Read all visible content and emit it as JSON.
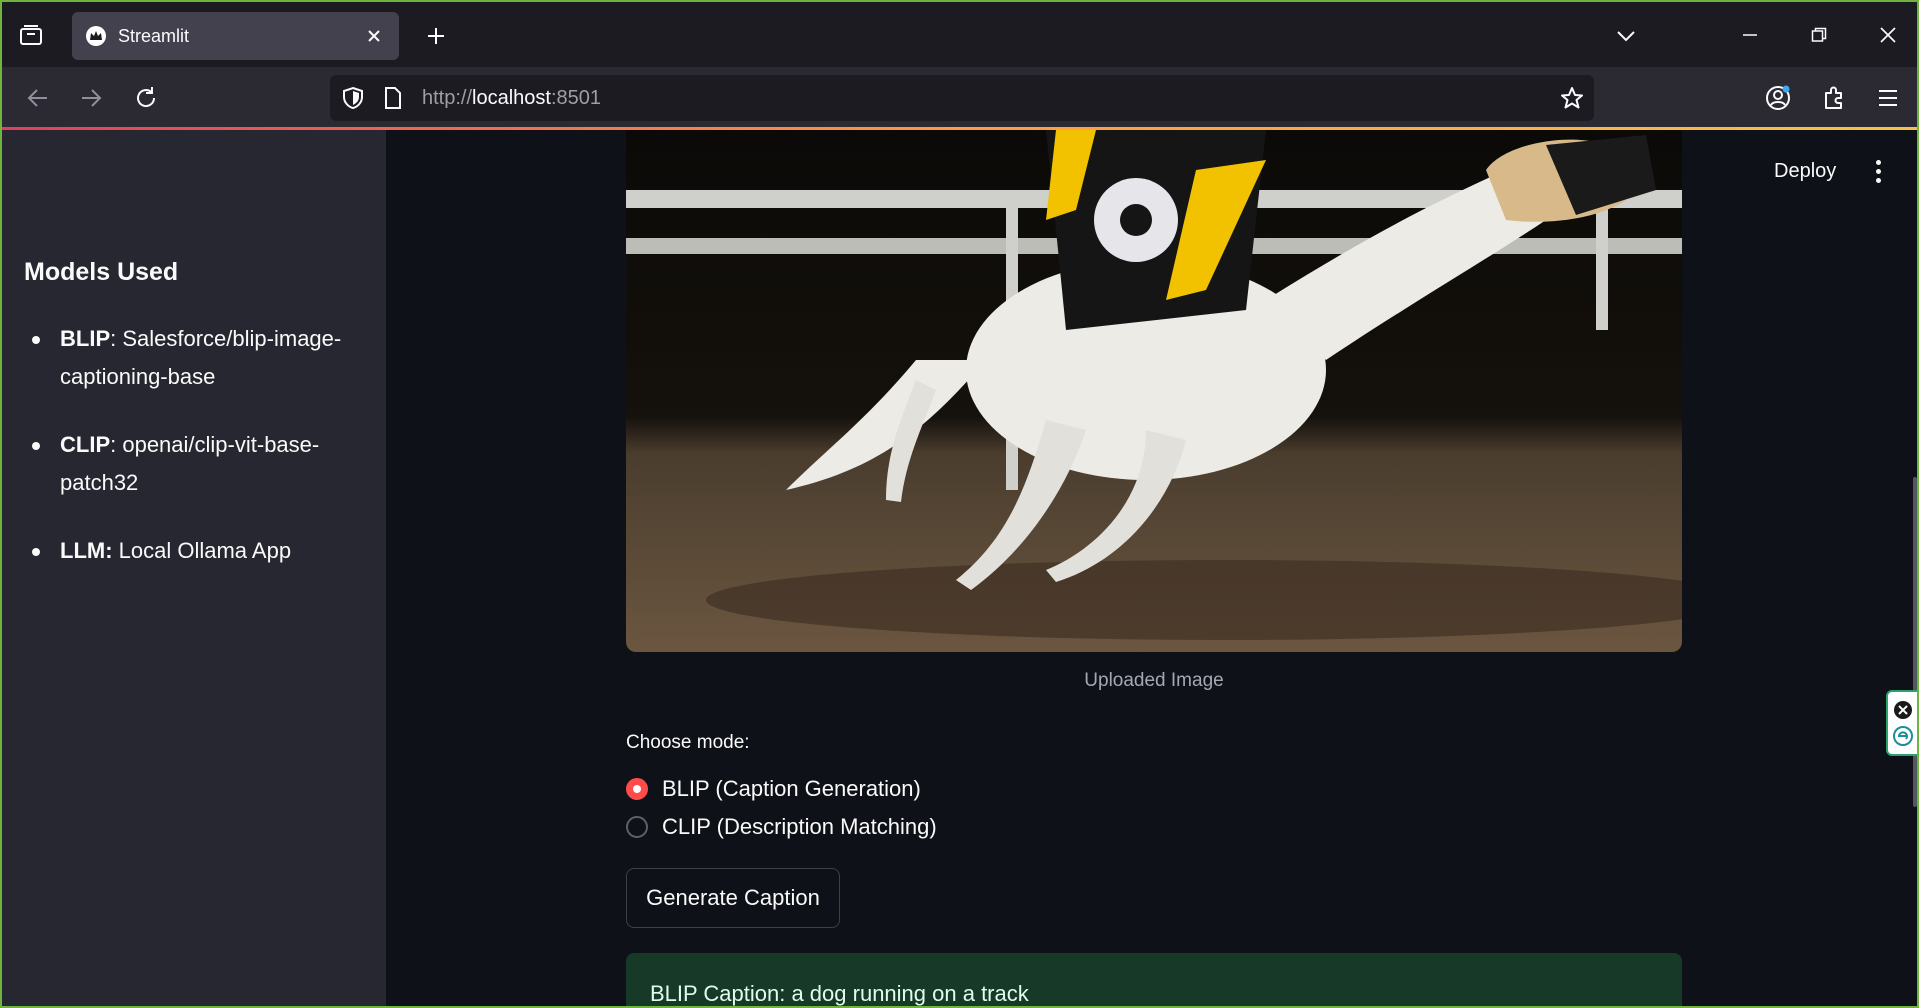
{
  "browser": {
    "tab_title": "Streamlit",
    "url_scheme": "http://",
    "url_host": "localhost",
    "url_port": ":8501"
  },
  "sidebar": {
    "heading": "Models Used",
    "items": [
      {
        "name": "BLIP",
        "value": ": Salesforce/blip-image-captioning-base"
      },
      {
        "name": "CLIP",
        "value": ": openai/clip-vit-base-patch32"
      },
      {
        "name": "LLM:",
        "value": " Local Ollama App"
      }
    ]
  },
  "header": {
    "deploy_label": "Deploy"
  },
  "main": {
    "image_caption": "Uploaded Image",
    "mode_label": "Choose mode:",
    "modes": [
      {
        "label": "BLIP (Caption Generation)",
        "selected": true
      },
      {
        "label": "CLIP (Description Matching)",
        "selected": false
      }
    ],
    "generate_button": "Generate Caption",
    "result_text": "BLIP Caption: a dog running on a track"
  },
  "colors": {
    "accent": "#ff4b4b",
    "sidebar_bg": "#262730",
    "main_bg": "#0e1117",
    "success_bg": "#173928"
  }
}
